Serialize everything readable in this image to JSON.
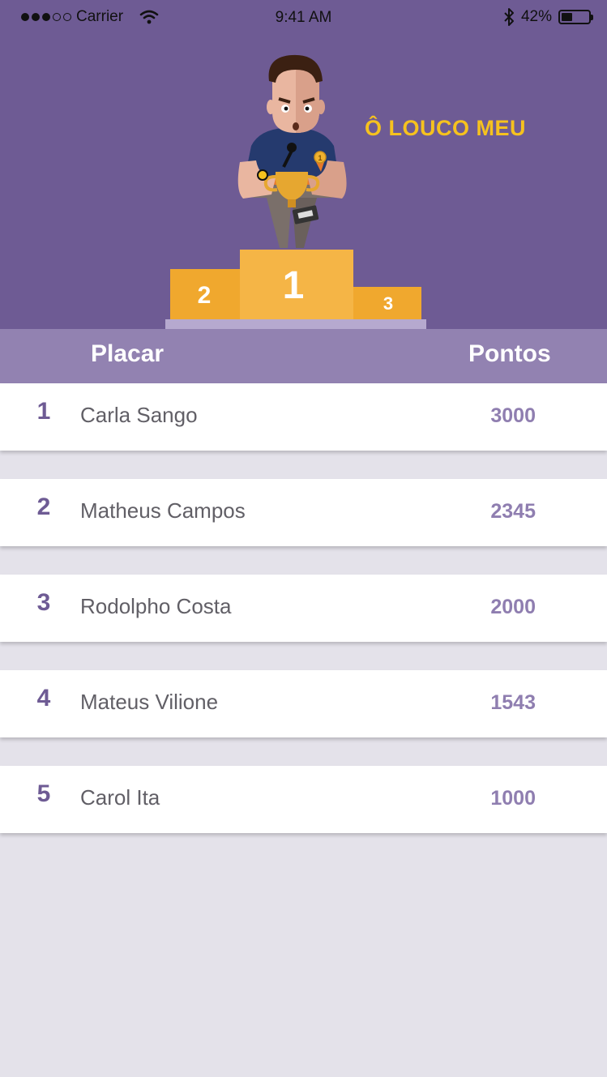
{
  "status_bar": {
    "carrier": "Carrier",
    "time": "9:41 AM",
    "battery": "42%",
    "battery_level": 0.42,
    "icons": [
      "signal-dots-icon",
      "wifi-icon",
      "bluetooth-icon",
      "battery-icon"
    ]
  },
  "hero": {
    "tagline": "Ô LOUCO MEU",
    "podium": {
      "first": "1",
      "second": "2",
      "third": "3"
    },
    "medal": "1"
  },
  "table": {
    "header_left": "Placar",
    "header_right": "Pontos",
    "rows": [
      {
        "rank": "1",
        "name": "Carla Sango",
        "points": "3000"
      },
      {
        "rank": "2",
        "name": "Matheus Campos",
        "points": "2345"
      },
      {
        "rank": "3",
        "name": "Rodolpho Costa",
        "points": "2000"
      },
      {
        "rank": "4",
        "name": "Mateus Vilione",
        "points": "1543"
      },
      {
        "rank": "5",
        "name": "Carol Ita",
        "points": "1000"
      }
    ]
  },
  "colors": {
    "hero_bg": "#6e5b94",
    "header_bg": "#9282b1",
    "page_bg": "#e4e2ea",
    "accent_yellow": "#f6c21e",
    "podium_orange": "#f0a82e",
    "podium_light": "#f5b546"
  }
}
